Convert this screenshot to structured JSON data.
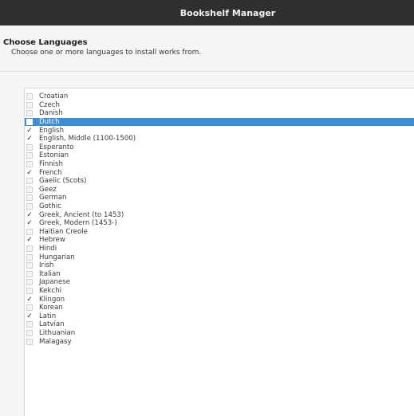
{
  "window": {
    "title": "Bookshelf Manager"
  },
  "header": {
    "title": "Choose Languages",
    "subtitle": "Choose one or more languages to install works from."
  },
  "languages": [
    {
      "label": "Croatian",
      "checked": false,
      "selected": false
    },
    {
      "label": "Czech",
      "checked": false,
      "selected": false
    },
    {
      "label": "Danish",
      "checked": false,
      "selected": false
    },
    {
      "label": "Dutch",
      "checked": false,
      "selected": true
    },
    {
      "label": "English",
      "checked": true,
      "selected": false
    },
    {
      "label": "English, Middle (1100-1500)",
      "checked": true,
      "selected": false
    },
    {
      "label": "Esperanto",
      "checked": false,
      "selected": false
    },
    {
      "label": "Estonian",
      "checked": false,
      "selected": false
    },
    {
      "label": "Finnish",
      "checked": false,
      "selected": false
    },
    {
      "label": "French",
      "checked": true,
      "selected": false
    },
    {
      "label": "Gaelic (Scots)",
      "checked": false,
      "selected": false
    },
    {
      "label": "Geez",
      "checked": false,
      "selected": false
    },
    {
      "label": "German",
      "checked": false,
      "selected": false
    },
    {
      "label": "Gothic",
      "checked": false,
      "selected": false
    },
    {
      "label": "Greek, Ancient (to 1453)",
      "checked": true,
      "selected": false
    },
    {
      "label": "Greek, Modern (1453-)",
      "checked": true,
      "selected": false
    },
    {
      "label": "Haitian Creole",
      "checked": false,
      "selected": false
    },
    {
      "label": "Hebrew",
      "checked": true,
      "selected": false
    },
    {
      "label": "Hindi",
      "checked": false,
      "selected": false
    },
    {
      "label": "Hungarian",
      "checked": false,
      "selected": false
    },
    {
      "label": "Irish",
      "checked": false,
      "selected": false
    },
    {
      "label": "Italian",
      "checked": false,
      "selected": false
    },
    {
      "label": "Japanese",
      "checked": false,
      "selected": false
    },
    {
      "label": "Kekchi",
      "checked": false,
      "selected": false
    },
    {
      "label": "Klingon",
      "checked": true,
      "selected": false
    },
    {
      "label": "Korean",
      "checked": false,
      "selected": false
    },
    {
      "label": "Latin",
      "checked": true,
      "selected": false
    },
    {
      "label": "Latvian",
      "checked": false,
      "selected": false
    },
    {
      "label": "Lithuanian",
      "checked": false,
      "selected": false
    },
    {
      "label": "Malagasy",
      "checked": false,
      "selected": false
    }
  ],
  "icons": {
    "checked_glyph": "✓",
    "checkbox": "checkbox-icon"
  },
  "colors": {
    "titlebar": "#303030",
    "selection": "#3d8fd5"
  }
}
